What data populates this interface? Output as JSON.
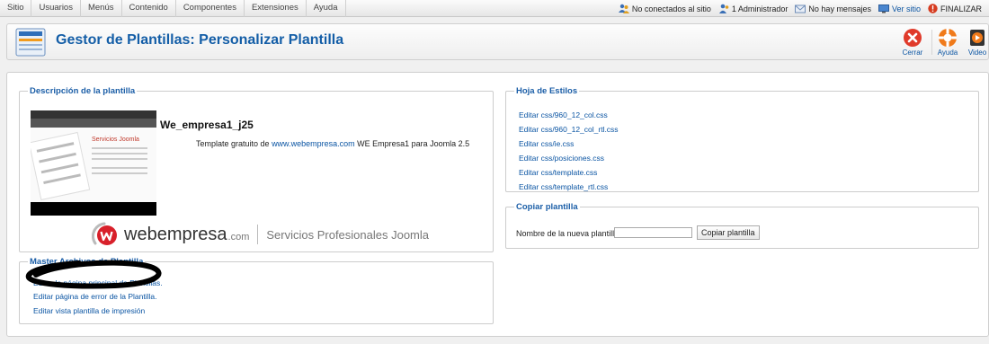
{
  "menu": {
    "items": [
      "Sitio",
      "Usuarios",
      "Menús",
      "Contenido",
      "Componentes",
      "Extensiones",
      "Ayuda"
    ]
  },
  "status": {
    "visitors": "No conectados al sitio",
    "admins": "1 Administrador",
    "messages": "No hay mensajes",
    "view_site": "Ver sitio",
    "logout": "FINALIZAR"
  },
  "toolbar": {
    "title": "Gestor de Plantillas: Personalizar Plantilla",
    "close_label": "Cerrar",
    "help_label": "Ayuda",
    "video_label": "Video"
  },
  "description": {
    "legend": "Descripción de la plantilla",
    "template_name": "We_empresa1_j25",
    "text_before": "Template gratuito de ",
    "link": "www.webempresa.com",
    "text_after": " WE Empresa1 para Joomla 2.5",
    "thumb_title": "Servicios Joomla",
    "brand_word": "webempresa",
    "brand_com": ".com",
    "brand_tagline": "Servicios Profesionales Joomla"
  },
  "master": {
    "legend": "Master Archivos de Plantilla",
    "links": [
      "Editar la página principal de Plantillas.",
      "Editar página de error de la Plantilla.",
      "Editar vista plantilla de impresión"
    ]
  },
  "stylesheets": {
    "legend": "Hoja de Estilos",
    "links": [
      "Editar css/960_12_col.css",
      "Editar css/960_12_col_rtl.css",
      "Editar css/ie.css",
      "Editar css/posiciones.css",
      "Editar css/template.css",
      "Editar css/template_rtl.css"
    ]
  },
  "copy": {
    "legend": "Copiar plantilla",
    "label": "Nombre de la nueva plantilla",
    "input_value": "",
    "button": "Copiar plantilla"
  },
  "colors": {
    "accent": "#145ea7",
    "link": "#0b55a3",
    "close_red": "#e03a2a",
    "help_orange": "#f07a1a"
  },
  "icons": [
    "users-icon",
    "admin-icon",
    "messages-icon",
    "monitor-icon",
    "logout-icon",
    "template-manager-icon",
    "close-icon",
    "help-icon",
    "video-icon"
  ]
}
